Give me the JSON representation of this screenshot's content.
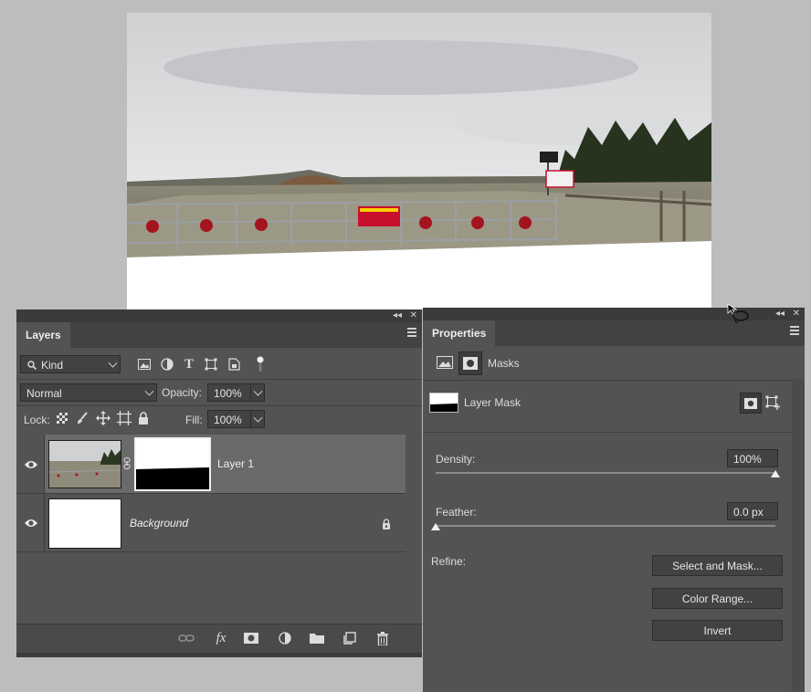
{
  "layers_panel": {
    "tab_label": "Layers",
    "filter": {
      "selected": "Kind"
    },
    "blend_mode": {
      "selected": "Normal"
    },
    "opacity": {
      "label": "Opacity:",
      "value": "100%"
    },
    "lock": {
      "label": "Lock:"
    },
    "fill": {
      "label": "Fill:",
      "value": "100%"
    },
    "layers": [
      {
        "name": "Layer 1",
        "visible": true,
        "selected": true,
        "has_mask": true
      },
      {
        "name": "Background",
        "visible": true,
        "locked": true,
        "italic": true
      }
    ],
    "footer_icons": [
      "link-icon",
      "fx-icon",
      "add-mask-icon",
      "adjustment-icon",
      "folder-icon",
      "new-layer-icon",
      "trash-icon"
    ],
    "fx_label": "fx"
  },
  "properties_panel": {
    "tab_label": "Properties",
    "section_label": "Masks",
    "mask_name": "Layer Mask",
    "density": {
      "label": "Density:",
      "value": "100%",
      "level": 1.0
    },
    "feather": {
      "label": "Feather:",
      "value": "0.0 px",
      "level": 0.0
    },
    "refine_label": "Refine:",
    "buttons": {
      "select_and_mask": "Select and Mask...",
      "color_range": "Color Range...",
      "invert": "Invert"
    }
  },
  "colors": {
    "panel_bg": "#535353",
    "tab_bar": "#424242",
    "selected_row": "#6a6a6a",
    "canvas_bg": "#bdbdbd",
    "sign_red": "#c8102e"
  }
}
